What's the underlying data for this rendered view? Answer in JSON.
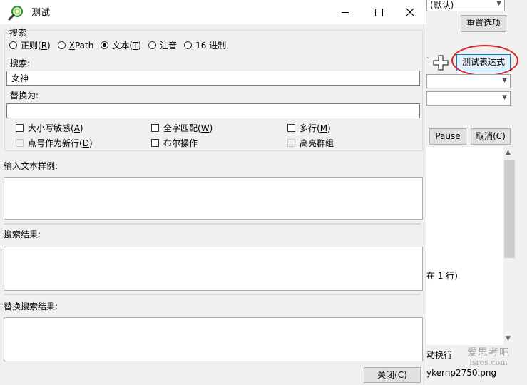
{
  "background_window": {
    "top_combo_value": "(默认)",
    "reset_options_label": "重置选项",
    "test_regex_label": "测试表达式",
    "pause_label": "Pause",
    "cancel_label": "取消(C)",
    "status_fragment": "在 1 行)",
    "wrap_fragment": "动换行",
    "file_fragment": "ykernp2750.png",
    "watermark_line1": "爱思考吧",
    "watermark_line2": "isres.com"
  },
  "dialog": {
    "title": "测试",
    "search_group_label": "搜索",
    "modes": [
      {
        "prefix": "正则(",
        "key": "R",
        "suffix": ")",
        "selected": false
      },
      {
        "prefix": "",
        "key": "X",
        "suffix": "Path",
        "selected": false
      },
      {
        "prefix": "文本(",
        "key": "T",
        "suffix": ")",
        "selected": true
      },
      {
        "prefix": "注音",
        "key": "",
        "suffix": "",
        "selected": false
      },
      {
        "prefix": "16 进制",
        "key": "",
        "suffix": "",
        "selected": false
      }
    ],
    "search_label": "搜索:",
    "search_value": "女神",
    "replace_label": "替换为:",
    "replace_value": "",
    "options": {
      "match_case": {
        "prefix": "大小写敏感(",
        "key": "A",
        "suffix": ")",
        "checked": false,
        "enabled": true
      },
      "whole_word": {
        "prefix": "全字匹配(",
        "key": "W",
        "suffix": ")",
        "checked": false,
        "enabled": true
      },
      "multiline": {
        "prefix": "多行(",
        "key": "M",
        "suffix": ")",
        "checked": false,
        "enabled": true
      },
      "dot_newline": {
        "prefix": "点号作为新行(",
        "key": "D",
        "suffix": ")",
        "checked": false,
        "enabled": false
      },
      "boolean_ops": {
        "prefix": "布尔操作",
        "key": "",
        "suffix": "",
        "checked": false,
        "enabled": true
      },
      "highlight_groups": {
        "prefix": "高亮群组",
        "key": "",
        "suffix": "",
        "checked": false,
        "enabled": false
      }
    },
    "sample_label": "输入文本样例:",
    "sample_value": "",
    "results_label": "搜索结果:",
    "results_value": "",
    "replace_results_label": "替换搜索结果:",
    "replace_results_value": "",
    "close_label": "关闭(C)",
    "close_prefix": "关闭(",
    "close_key": "C",
    "close_suffix": ")"
  }
}
